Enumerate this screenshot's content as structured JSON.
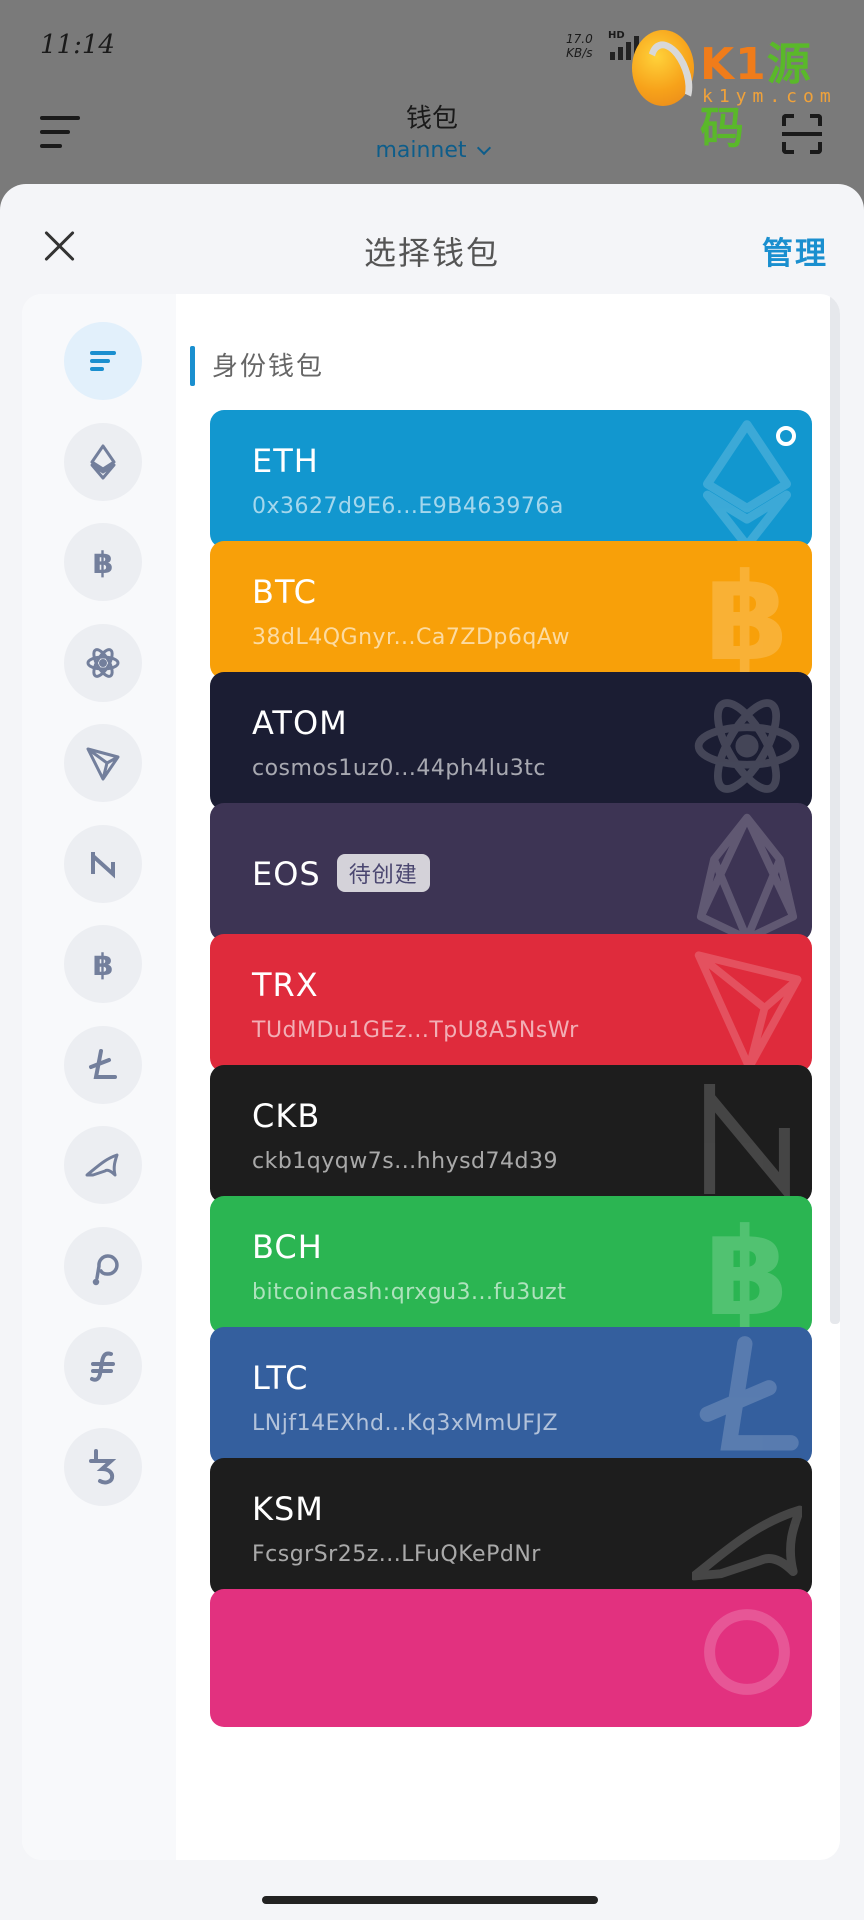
{
  "status_bar": {
    "time": "11:14",
    "net_speed_value": "17.0",
    "net_speed_unit": "KB/s",
    "hd_label": "HD"
  },
  "watermark": {
    "title_a": "K1",
    "title_b": "源码",
    "url": "k1ym.com"
  },
  "header": {
    "title": "钱包",
    "network": "mainnet"
  },
  "sheet": {
    "title": "选择钱包",
    "manage_label": "管理"
  },
  "section": {
    "label": "身份钱包"
  },
  "chains_sidebar": [
    {
      "icon": "list-icon",
      "active": true
    },
    {
      "icon": "ethereum-icon"
    },
    {
      "icon": "bitcoin-icon"
    },
    {
      "icon": "cosmos-atom-icon"
    },
    {
      "icon": "tron-icon"
    },
    {
      "icon": "nervos-ckb-icon"
    },
    {
      "icon": "bitcoin-cash-icon"
    },
    {
      "icon": "litecoin-icon"
    },
    {
      "icon": "kusama-icon"
    },
    {
      "icon": "polkadot-icon"
    },
    {
      "icon": "filecoin-icon"
    },
    {
      "icon": "tezos-icon"
    }
  ],
  "wallets": [
    {
      "name": "ETH",
      "address": "0x3627d9E6...E9B463976a",
      "color": "#1297cf",
      "glyph": "ethereum",
      "selected": true
    },
    {
      "name": "BTC",
      "address": "38dL4QGnyr...Ca7ZDp6qAw",
      "color": "#f8a009",
      "glyph": "bitcoin"
    },
    {
      "name": "ATOM",
      "address": "cosmos1uz0...44ph4lu3tc",
      "color": "#1b1d33",
      "glyph": "atom"
    },
    {
      "name": "EOS",
      "address": "",
      "badge": "待创建",
      "color": "#3d3454",
      "glyph": "eos"
    },
    {
      "name": "TRX",
      "address": "TUdMDu1GEz...TpU8A5NsWr",
      "color": "#df2b3c",
      "glyph": "tron"
    },
    {
      "name": "CKB",
      "address": "ckb1qyqw7s...hhysd74d39",
      "color": "#1d1d1d",
      "glyph": "ckb"
    },
    {
      "name": "BCH",
      "address": "bitcoincash:qrxgu3...fu3uzt",
      "color": "#2bb552",
      "glyph": "bitcoin"
    },
    {
      "name": "LTC",
      "address": "LNjf14EXhd...Kq3xMmUFJZ",
      "color": "#345f9e",
      "glyph": "litecoin"
    },
    {
      "name": "KSM",
      "address": "FcsgrSr25z...LFuQKePdNr",
      "color": "#1d1d1d",
      "glyph": "kusama"
    },
    {
      "name": "",
      "address": "",
      "color": "#e2317f",
      "glyph": "polkadot"
    }
  ]
}
